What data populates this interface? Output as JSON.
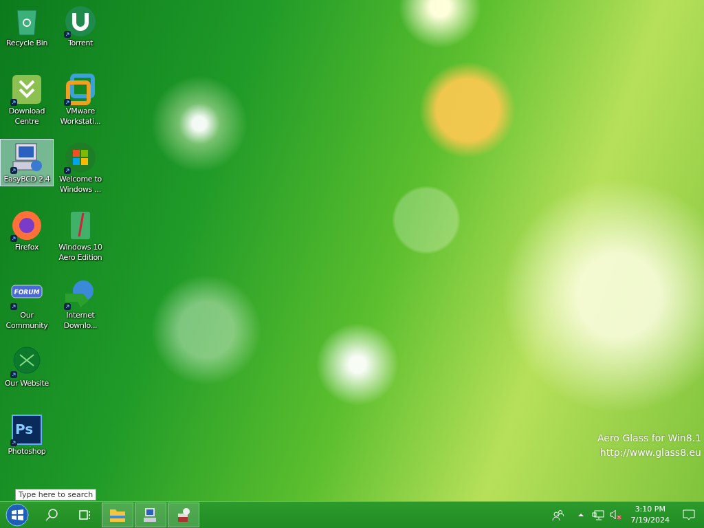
{
  "desktop_icons": [
    {
      "label": "Recycle Bin",
      "kind": "recycle",
      "shortcut": false,
      "selected": false
    },
    {
      "label": "Download Centre",
      "kind": "download",
      "shortcut": true,
      "selected": false
    },
    {
      "label": "EasyBCD 2.4",
      "kind": "easybcd",
      "shortcut": true,
      "selected": true
    },
    {
      "label": "Firefox",
      "kind": "firefox",
      "shortcut": true,
      "selected": false
    },
    {
      "label": "Our Community",
      "kind": "forum",
      "shortcut": true,
      "selected": false,
      "icon_text": "FORUM"
    },
    {
      "label": "Our Website",
      "kind": "globe",
      "shortcut": true,
      "selected": false
    },
    {
      "label": "Photoshop",
      "kind": "photoshop",
      "shortcut": true,
      "selected": false,
      "icon_text": "Ps"
    },
    {
      "label": "Torrent",
      "kind": "torrent",
      "shortcut": true,
      "selected": false
    },
    {
      "label": "VMware Workstati...",
      "kind": "vmware",
      "shortcut": true,
      "selected": false
    },
    {
      "label": "Welcome to Windows ...",
      "kind": "windows",
      "shortcut": true,
      "selected": false
    },
    {
      "label": "Windows 10 Aero Edition",
      "kind": "notebook",
      "shortcut": false,
      "selected": false
    },
    {
      "label": "Internet Downlo...",
      "kind": "idm",
      "shortcut": true,
      "selected": false
    }
  ],
  "watermark": {
    "line_1": "Aero Glass for Win8.1",
    "line_2": "http://www.glass8.eu"
  },
  "search_tooltip": "Type here to search",
  "taskbar": {
    "pinned": [
      {
        "kind": "folder"
      },
      {
        "kind": "easybcd"
      },
      {
        "kind": "installer"
      }
    ],
    "clock": {
      "time": "3:10 PM",
      "date": "7/19/2024"
    }
  }
}
